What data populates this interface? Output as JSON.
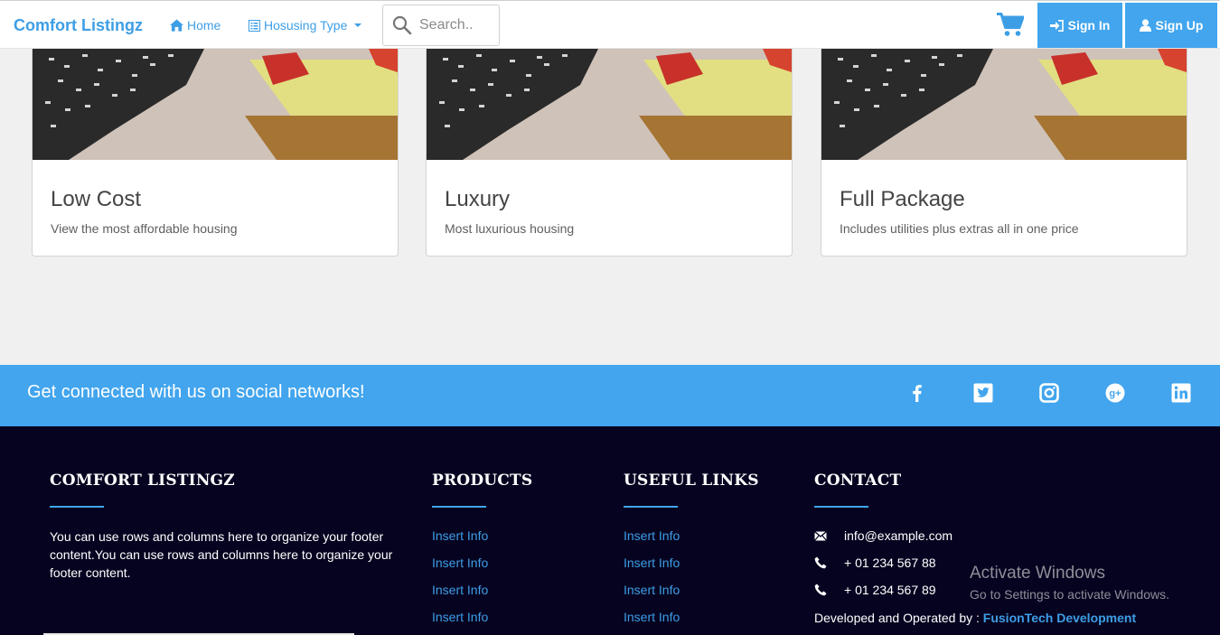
{
  "navbar": {
    "brand": "Comfort Listingz",
    "home_label": "Home",
    "housing_type_label": "Hosusing Type",
    "search_placeholder": "Search..",
    "signin_label": "Sign In",
    "signup_label": "Sign Up"
  },
  "cards": [
    {
      "title": "Low Cost",
      "text": "View the most affordable housing"
    },
    {
      "title": "Luxury",
      "text": "Most luxurious housing"
    },
    {
      "title": "Full Package",
      "text": "Includes utilities plus extras all in one price"
    }
  ],
  "social": {
    "text": "Get connected with us on social networks!",
    "icons": [
      "facebook-icon",
      "twitter-icon",
      "instagram-icon",
      "google-plus-icon",
      "linkedin-icon"
    ]
  },
  "footer": {
    "about_heading": "COMFORT LISTINGZ",
    "about_text": "You can use rows and columns here to organize your footer content.You can use rows and columns here to organize your footer content.",
    "products_heading": "PRODUCTS",
    "products_links": [
      "Insert Info",
      "Insert Info",
      "Insert Info",
      "Insert Info"
    ],
    "useful_heading": "USEFUL LINKS",
    "useful_links": [
      "Insert Info",
      "Insert Info",
      "Insert Info",
      "Insert Info"
    ],
    "contact_heading": "CONTACT",
    "contact_email": "info@example.com",
    "contact_phone_1": "+ 01 234 567 88",
    "contact_phone_2": "+ 01 234 567 89",
    "developed_label": "Developed and Operated by : ",
    "developer_name": "FusionTech Development"
  },
  "watermark": {
    "title": "Activate Windows",
    "subtitle": "Go to Settings to activate Windows."
  },
  "colors": {
    "accent": "#42a5ee",
    "footer_bg": "#060320",
    "page_bg": "#f0f0f0"
  }
}
